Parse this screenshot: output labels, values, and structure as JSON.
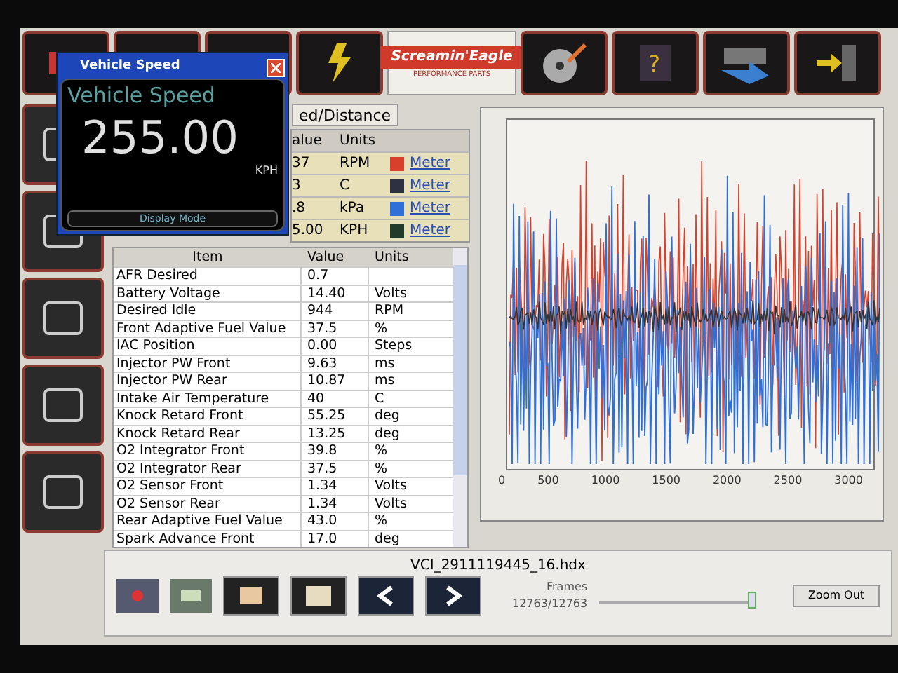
{
  "logo": {
    "text": "Screamin'Eagle",
    "subtitle": "PERFORMANCE PARTS"
  },
  "help_glyph": "?",
  "tab": {
    "label": "ed/Distance",
    "selected": true
  },
  "meter_table": {
    "columns": [
      "alue",
      "Units"
    ],
    "rows": [
      {
        "value": "37",
        "units": "RPM",
        "color": "#d8402c",
        "link": "Meter"
      },
      {
        "value": "3",
        "units": "C",
        "color": "#2e3142",
        "link": "Meter"
      },
      {
        "value": ".8",
        "units": "kPa",
        "color": "#2f6fd8",
        "link": "Meter"
      },
      {
        "value": "5.00",
        "units": "KPH",
        "color": "#213a2a",
        "link": "Meter"
      }
    ]
  },
  "popup": {
    "title": "Vehicle Speed",
    "heading": "Vehicle Speed",
    "reading": "255.00",
    "unit": "KPH",
    "mode_button": "Display Mode"
  },
  "data_table": {
    "columns": [
      "Item",
      "Value",
      "Units"
    ],
    "rows": [
      {
        "item": "AFR Desired",
        "value": "0.7",
        "units": ""
      },
      {
        "item": "Battery Voltage",
        "value": "14.40",
        "units": "Volts"
      },
      {
        "item": "Desired Idle",
        "value": "944",
        "units": "RPM"
      },
      {
        "item": "Front Adaptive Fuel Value",
        "value": "37.5",
        "units": "%"
      },
      {
        "item": "IAC Position",
        "value": "0.00",
        "units": "Steps"
      },
      {
        "item": "Injector PW Front",
        "value": "9.63",
        "units": "ms"
      },
      {
        "item": "Injector PW Rear",
        "value": "10.87",
        "units": "ms"
      },
      {
        "item": "Intake Air Temperature",
        "value": "40",
        "units": "C"
      },
      {
        "item": "Knock Retard Front",
        "value": "55.25",
        "units": "deg"
      },
      {
        "item": "Knock Retard Rear",
        "value": "13.25",
        "units": "deg"
      },
      {
        "item": "O2 Integrator Front",
        "value": "39.8",
        "units": "%"
      },
      {
        "item": "O2 Integrator Rear",
        "value": "37.5",
        "units": "%"
      },
      {
        "item": "O2 Sensor Front",
        "value": "1.34",
        "units": "Volts"
      },
      {
        "item": "O2 Sensor Rear",
        "value": "1.34",
        "units": "Volts"
      },
      {
        "item": "Rear Adaptive Fuel Value",
        "value": "43.0",
        "units": "%"
      },
      {
        "item": "Spark Advance Front",
        "value": "17.0",
        "units": "deg"
      }
    ]
  },
  "plot": {
    "x_tick_labels": [
      "0",
      "500",
      "1000",
      "1500",
      "2000",
      "2500",
      "3000"
    ]
  },
  "playback": {
    "file_name": "VCI_2911119445_16.hdx",
    "frames_label": "Frames",
    "frames_count": "12763/12763",
    "level": 1,
    "zoom_button": "Zoom Out"
  }
}
